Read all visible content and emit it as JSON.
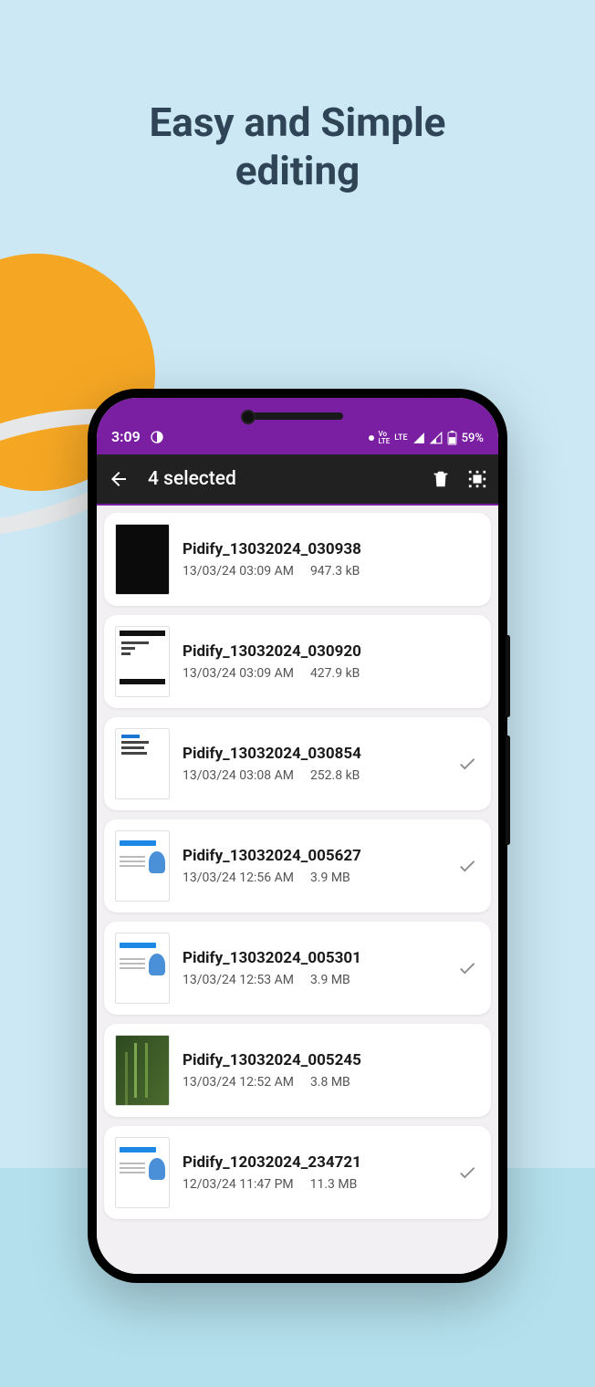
{
  "headline_l1": "Easy and Simple",
  "headline_l2": "editing",
  "statusbar": {
    "time": "3:09",
    "network_label": "LTE",
    "volte_label": "Vo",
    "battery_text": "59%"
  },
  "appbar": {
    "title": "4 selected"
  },
  "rows": [
    {
      "title": "Pidify_13032024_030938",
      "date": "13/03/24 03:09 AM",
      "size": "947.3 kB",
      "selected": false,
      "thumb": "dark"
    },
    {
      "title": "Pidify_13032024_030920",
      "date": "13/03/24 03:09 AM",
      "size": "427.9 kB",
      "selected": false,
      "thumb": "doc"
    },
    {
      "title": "Pidify_13032024_030854",
      "date": "13/03/24 03:08 AM",
      "size": "252.8 kB",
      "selected": true,
      "thumb": "doc2"
    },
    {
      "title": "Pidify_13032024_005627",
      "date": "13/03/24 12:56 AM",
      "size": "3.9 MB",
      "selected": true,
      "thumb": "app"
    },
    {
      "title": "Pidify_13032024_005301",
      "date": "13/03/24 12:53 AM",
      "size": "3.9 MB",
      "selected": true,
      "thumb": "app"
    },
    {
      "title": "Pidify_13032024_005245",
      "date": "13/03/24 12:52 AM",
      "size": "3.8 MB",
      "selected": false,
      "thumb": "green"
    },
    {
      "title": "Pidify_12032024_234721",
      "date": "12/03/24 11:47 PM",
      "size": "11.3 MB",
      "selected": true,
      "thumb": "app"
    }
  ]
}
